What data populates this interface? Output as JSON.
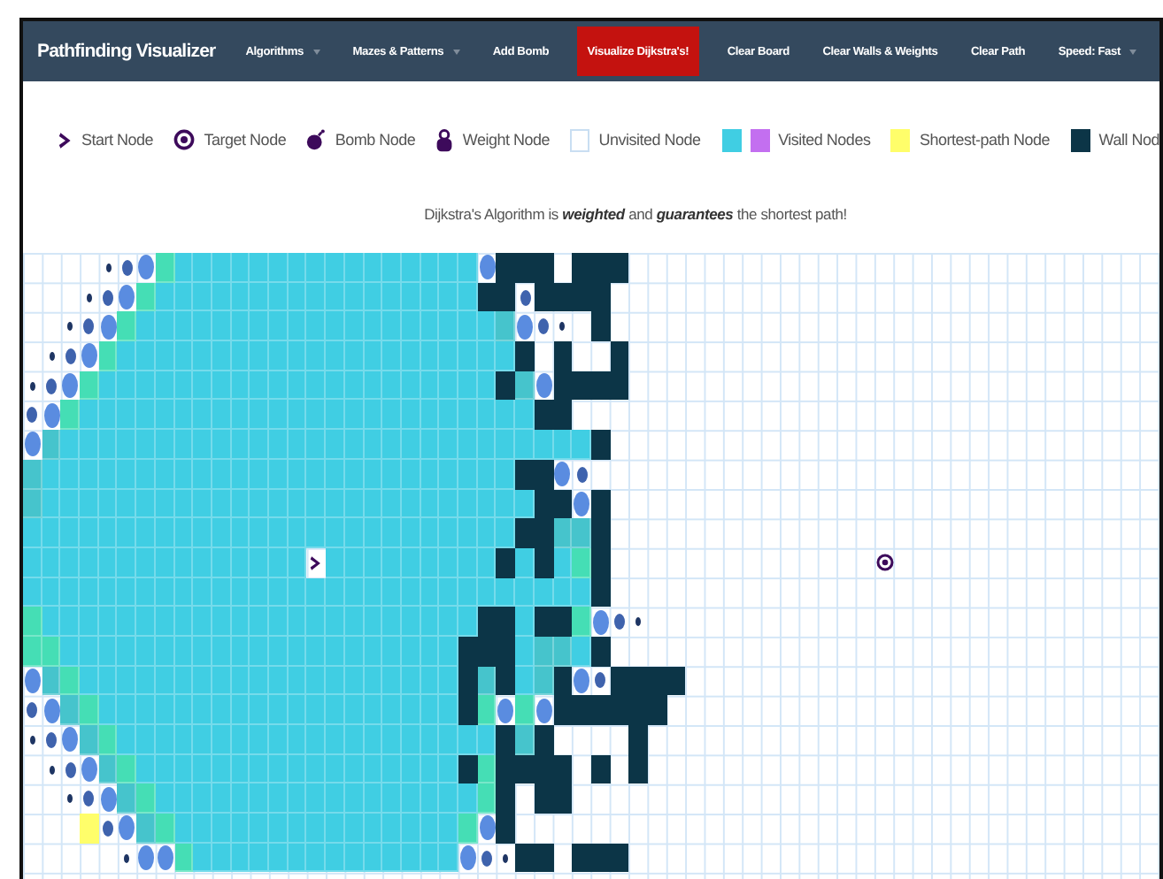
{
  "navbar": {
    "brand": "Pathfinding Visualizer",
    "items": [
      {
        "label": "Algorithms",
        "kind": "dropdown"
      },
      {
        "label": "Mazes & Patterns",
        "kind": "dropdown"
      },
      {
        "label": "Add Bomb",
        "kind": "link"
      },
      {
        "label": "Visualize Dijkstra's!",
        "kind": "primary"
      },
      {
        "label": "Clear Board",
        "kind": "link"
      },
      {
        "label": "Clear Walls & Weights",
        "kind": "link"
      },
      {
        "label": "Clear Path",
        "kind": "link"
      },
      {
        "label": "Speed: Fast",
        "kind": "dropdown"
      }
    ]
  },
  "legend": [
    {
      "kind": "start",
      "label": "Start Node"
    },
    {
      "kind": "target",
      "label": "Target Node"
    },
    {
      "kind": "bomb",
      "label": "Bomb Node"
    },
    {
      "kind": "weight",
      "label": "Weight Node"
    },
    {
      "kind": "unvisited",
      "label": "Unvisited Node"
    },
    {
      "kind": "visited",
      "label": "Visited Nodes"
    },
    {
      "kind": "shortest",
      "label": "Shortest-path Node"
    },
    {
      "kind": "wall",
      "label": "Wall Nod"
    }
  ],
  "description": "Dijkstra's Algorithm is **weighted** and **guarantees** the shortest path!",
  "grid": {
    "rows": [
      {
        "cells": [
          {
            "kind": "open"
          },
          {
            "kind": "open"
          },
          {
            "kind": "open"
          },
          {
            "kind": "open"
          },
          {
            "kind": "far"
          },
          {
            "kind": "queued"
          },
          {
            "kind": "next"
          },
          {
            "kind": "new"
          },
          {
            "kind": "seen"
          },
          {
            "kind": "seen"
          },
          {
            "kind": "seen"
          },
          {
            "kind": "seen"
          },
          {
            "kind": "seen"
          },
          {
            "kind": "seen"
          },
          {
            "kind": "seen"
          },
          {
            "kind": "seen"
          },
          {
            "kind": "seen"
          },
          {
            "kind": "seen"
          },
          {
            "kind": "seen"
          },
          {
            "kind": "seen"
          },
          {
            "kind": "seen"
          },
          {
            "kind": "seen"
          },
          {
            "kind": "seen"
          },
          {
            "kind": "seen"
          },
          {
            "kind": "next"
          },
          {
            "kind": "wall"
          },
          {
            "kind": "wall"
          },
          {
            "kind": "wall"
          },
          {
            "kind": "open"
          },
          {
            "kind": "wall"
          },
          {
            "kind": "wall"
          },
          {
            "kind": "wall"
          }
        ]
      },
      {
        "cells": [
          {
            "kind": "open"
          },
          {
            "kind": "open"
          },
          {
            "kind": "open"
          },
          {
            "kind": "far"
          },
          {
            "kind": "queued"
          },
          {
            "kind": "next"
          },
          {
            "kind": "new"
          },
          {
            "kind": "seen"
          },
          {
            "kind": "seen"
          },
          {
            "kind": "seen"
          },
          {
            "kind": "seen"
          },
          {
            "kind": "seen"
          },
          {
            "kind": "seen"
          },
          {
            "kind": "seen"
          },
          {
            "kind": "seen"
          },
          {
            "kind": "seen"
          },
          {
            "kind": "seen"
          },
          {
            "kind": "seen"
          },
          {
            "kind": "seen"
          },
          {
            "kind": "seen"
          },
          {
            "kind": "seen"
          },
          {
            "kind": "seen"
          },
          {
            "kind": "seen"
          },
          {
            "kind": "seen"
          },
          {
            "kind": "wall"
          },
          {
            "kind": "wall"
          },
          {
            "kind": "queued"
          },
          {
            "kind": "wall"
          },
          {
            "kind": "wall"
          },
          {
            "kind": "wall"
          },
          {
            "kind": "wall"
          }
        ]
      },
      {
        "cells": [
          {
            "kind": "open"
          },
          {
            "kind": "open"
          },
          {
            "kind": "far"
          },
          {
            "kind": "queued"
          },
          {
            "kind": "next"
          },
          {
            "kind": "new"
          },
          {
            "kind": "seen"
          },
          {
            "kind": "seen"
          },
          {
            "kind": "seen"
          },
          {
            "kind": "seen"
          },
          {
            "kind": "seen"
          },
          {
            "kind": "seen"
          },
          {
            "kind": "seen"
          },
          {
            "kind": "seen"
          },
          {
            "kind": "seen"
          },
          {
            "kind": "seen"
          },
          {
            "kind": "seen"
          },
          {
            "kind": "seen"
          },
          {
            "kind": "seen"
          },
          {
            "kind": "seen"
          },
          {
            "kind": "seen"
          },
          {
            "kind": "seen"
          },
          {
            "kind": "seen"
          },
          {
            "kind": "seen"
          },
          {
            "kind": "seen"
          },
          {
            "kind": "near"
          },
          {
            "kind": "next"
          },
          {
            "kind": "queued"
          },
          {
            "kind": "far"
          },
          {
            "kind": "open"
          },
          {
            "kind": "wall"
          }
        ]
      },
      {
        "cells": [
          {
            "kind": "open"
          },
          {
            "kind": "far"
          },
          {
            "kind": "queued"
          },
          {
            "kind": "next"
          },
          {
            "kind": "new"
          },
          {
            "kind": "seen"
          },
          {
            "kind": "seen"
          },
          {
            "kind": "seen"
          },
          {
            "kind": "seen"
          },
          {
            "kind": "seen"
          },
          {
            "kind": "seen"
          },
          {
            "kind": "seen"
          },
          {
            "kind": "seen"
          },
          {
            "kind": "seen"
          },
          {
            "kind": "seen"
          },
          {
            "kind": "seen"
          },
          {
            "kind": "seen"
          },
          {
            "kind": "seen"
          },
          {
            "kind": "seen"
          },
          {
            "kind": "seen"
          },
          {
            "kind": "seen"
          },
          {
            "kind": "seen"
          },
          {
            "kind": "seen"
          },
          {
            "kind": "seen"
          },
          {
            "kind": "seen"
          },
          {
            "kind": "seen"
          },
          {
            "kind": "wall"
          },
          {
            "kind": "open"
          },
          {
            "kind": "wall"
          },
          {
            "kind": "open"
          },
          {
            "kind": "open"
          },
          {
            "kind": "wall"
          }
        ]
      },
      {
        "cells": [
          {
            "kind": "far"
          },
          {
            "kind": "queued"
          },
          {
            "kind": "next"
          },
          {
            "kind": "new"
          },
          {
            "kind": "seen"
          },
          {
            "kind": "seen"
          },
          {
            "kind": "seen"
          },
          {
            "kind": "seen"
          },
          {
            "kind": "seen"
          },
          {
            "kind": "seen"
          },
          {
            "kind": "seen"
          },
          {
            "kind": "seen"
          },
          {
            "kind": "seen"
          },
          {
            "kind": "seen"
          },
          {
            "kind": "seen"
          },
          {
            "kind": "seen"
          },
          {
            "kind": "seen"
          },
          {
            "kind": "seen"
          },
          {
            "kind": "seen"
          },
          {
            "kind": "seen"
          },
          {
            "kind": "seen"
          },
          {
            "kind": "seen"
          },
          {
            "kind": "seen"
          },
          {
            "kind": "seen"
          },
          {
            "kind": "seen"
          },
          {
            "kind": "wall"
          },
          {
            "kind": "near"
          },
          {
            "kind": "next"
          },
          {
            "kind": "wall"
          },
          {
            "kind": "wall"
          },
          {
            "kind": "wall"
          },
          {
            "kind": "wall"
          }
        ]
      },
      {
        "cells": [
          {
            "kind": "queued"
          },
          {
            "kind": "next"
          },
          {
            "kind": "new"
          },
          {
            "kind": "seen"
          },
          {
            "kind": "seen"
          },
          {
            "kind": "seen"
          },
          {
            "kind": "seen"
          },
          {
            "kind": "seen"
          },
          {
            "kind": "seen"
          },
          {
            "kind": "seen"
          },
          {
            "kind": "seen"
          },
          {
            "kind": "seen"
          },
          {
            "kind": "seen"
          },
          {
            "kind": "seen"
          },
          {
            "kind": "seen"
          },
          {
            "kind": "seen"
          },
          {
            "kind": "seen"
          },
          {
            "kind": "seen"
          },
          {
            "kind": "seen"
          },
          {
            "kind": "seen"
          },
          {
            "kind": "seen"
          },
          {
            "kind": "seen"
          },
          {
            "kind": "seen"
          },
          {
            "kind": "seen"
          },
          {
            "kind": "seen"
          },
          {
            "kind": "seen"
          },
          {
            "kind": "seen"
          },
          {
            "kind": "wall"
          },
          {
            "kind": "wall"
          }
        ]
      },
      {
        "cells": [
          {
            "kind": "next"
          },
          {
            "kind": "near"
          },
          {
            "kind": "seen"
          },
          {
            "kind": "seen"
          },
          {
            "kind": "seen"
          },
          {
            "kind": "seen"
          },
          {
            "kind": "seen"
          },
          {
            "kind": "seen"
          },
          {
            "kind": "seen"
          },
          {
            "kind": "seen"
          },
          {
            "kind": "seen"
          },
          {
            "kind": "seen"
          },
          {
            "kind": "seen"
          },
          {
            "kind": "seen"
          },
          {
            "kind": "seen"
          },
          {
            "kind": "seen"
          },
          {
            "kind": "seen"
          },
          {
            "kind": "seen"
          },
          {
            "kind": "seen"
          },
          {
            "kind": "seen"
          },
          {
            "kind": "seen"
          },
          {
            "kind": "seen"
          },
          {
            "kind": "seen"
          },
          {
            "kind": "seen"
          },
          {
            "kind": "seen"
          },
          {
            "kind": "seen"
          },
          {
            "kind": "seen"
          },
          {
            "kind": "seen"
          },
          {
            "kind": "seen"
          },
          {
            "kind": "seen"
          },
          {
            "kind": "wall"
          }
        ]
      },
      {
        "cells": [
          {
            "kind": "near"
          },
          {
            "kind": "seen"
          },
          {
            "kind": "seen"
          },
          {
            "kind": "seen"
          },
          {
            "kind": "seen"
          },
          {
            "kind": "seen"
          },
          {
            "kind": "seen"
          },
          {
            "kind": "seen"
          },
          {
            "kind": "seen"
          },
          {
            "kind": "seen"
          },
          {
            "kind": "seen"
          },
          {
            "kind": "seen"
          },
          {
            "kind": "seen"
          },
          {
            "kind": "seen"
          },
          {
            "kind": "seen"
          },
          {
            "kind": "seen"
          },
          {
            "kind": "seen"
          },
          {
            "kind": "seen"
          },
          {
            "kind": "seen"
          },
          {
            "kind": "seen"
          },
          {
            "kind": "seen"
          },
          {
            "kind": "seen"
          },
          {
            "kind": "seen"
          },
          {
            "kind": "seen"
          },
          {
            "kind": "seen"
          },
          {
            "kind": "seen"
          },
          {
            "kind": "wall"
          },
          {
            "kind": "wall"
          },
          {
            "kind": "next"
          },
          {
            "kind": "queued"
          }
        ]
      },
      {
        "cells": [
          {
            "kind": "near"
          },
          {
            "kind": "seen"
          },
          {
            "kind": "seen"
          },
          {
            "kind": "seen"
          },
          {
            "kind": "seen"
          },
          {
            "kind": "seen"
          },
          {
            "kind": "seen"
          },
          {
            "kind": "seen"
          },
          {
            "kind": "seen"
          },
          {
            "kind": "seen"
          },
          {
            "kind": "seen"
          },
          {
            "kind": "seen"
          },
          {
            "kind": "seen"
          },
          {
            "kind": "seen"
          },
          {
            "kind": "seen"
          },
          {
            "kind": "seen"
          },
          {
            "kind": "seen"
          },
          {
            "kind": "seen"
          },
          {
            "kind": "seen"
          },
          {
            "kind": "seen"
          },
          {
            "kind": "seen"
          },
          {
            "kind": "seen"
          },
          {
            "kind": "seen"
          },
          {
            "kind": "seen"
          },
          {
            "kind": "seen"
          },
          {
            "kind": "seen"
          },
          {
            "kind": "seen"
          },
          {
            "kind": "wall"
          },
          {
            "kind": "wall"
          },
          {
            "kind": "next"
          },
          {
            "kind": "wall"
          }
        ]
      },
      {
        "cells": [
          {
            "kind": "seen"
          },
          {
            "kind": "seen"
          },
          {
            "kind": "seen"
          },
          {
            "kind": "seen"
          },
          {
            "kind": "seen"
          },
          {
            "kind": "seen"
          },
          {
            "kind": "seen"
          },
          {
            "kind": "seen"
          },
          {
            "kind": "seen"
          },
          {
            "kind": "seen"
          },
          {
            "kind": "seen"
          },
          {
            "kind": "seen"
          },
          {
            "kind": "seen"
          },
          {
            "kind": "seen"
          },
          {
            "kind": "seen"
          },
          {
            "kind": "seen"
          },
          {
            "kind": "seen"
          },
          {
            "kind": "seen"
          },
          {
            "kind": "seen"
          },
          {
            "kind": "seen"
          },
          {
            "kind": "seen"
          },
          {
            "kind": "seen"
          },
          {
            "kind": "seen"
          },
          {
            "kind": "seen"
          },
          {
            "kind": "seen"
          },
          {
            "kind": "seen"
          },
          {
            "kind": "wall"
          },
          {
            "kind": "wall"
          },
          {
            "kind": "near"
          },
          {
            "kind": "near"
          },
          {
            "kind": "wall"
          }
        ]
      },
      {
        "cells": [
          {
            "kind": "seen"
          },
          {
            "kind": "seen"
          },
          {
            "kind": "seen"
          },
          {
            "kind": "seen"
          },
          {
            "kind": "seen"
          },
          {
            "kind": "seen"
          },
          {
            "kind": "seen"
          },
          {
            "kind": "seen"
          },
          {
            "kind": "seen"
          },
          {
            "kind": "seen"
          },
          {
            "kind": "seen"
          },
          {
            "kind": "seen"
          },
          {
            "kind": "seen"
          },
          {
            "kind": "seen"
          },
          {
            "kind": "seen"
          },
          {
            "kind": "start"
          },
          {
            "kind": "seen"
          },
          {
            "kind": "seen"
          },
          {
            "kind": "seen"
          },
          {
            "kind": "seen"
          },
          {
            "kind": "seen"
          },
          {
            "kind": "seen"
          },
          {
            "kind": "seen"
          },
          {
            "kind": "seen"
          },
          {
            "kind": "seen"
          },
          {
            "kind": "wall"
          },
          {
            "kind": "seen"
          },
          {
            "kind": "wall"
          },
          {
            "kind": "seen"
          },
          {
            "kind": "new"
          },
          {
            "kind": "wall"
          },
          {
            "kind": "open"
          },
          {
            "kind": "open"
          },
          {
            "kind": "open"
          },
          {
            "kind": "open"
          },
          {
            "kind": "open"
          },
          {
            "kind": "open"
          },
          {
            "kind": "open"
          },
          {
            "kind": "open"
          },
          {
            "kind": "open"
          },
          {
            "kind": "open"
          },
          {
            "kind": "open"
          },
          {
            "kind": "open"
          },
          {
            "kind": "open"
          },
          {
            "kind": "open"
          },
          {
            "kind": "target"
          }
        ]
      },
      {
        "cells": [
          {
            "kind": "seen"
          },
          {
            "kind": "seen"
          },
          {
            "kind": "seen"
          },
          {
            "kind": "seen"
          },
          {
            "kind": "seen"
          },
          {
            "kind": "seen"
          },
          {
            "kind": "seen"
          },
          {
            "kind": "seen"
          },
          {
            "kind": "seen"
          },
          {
            "kind": "seen"
          },
          {
            "kind": "seen"
          },
          {
            "kind": "seen"
          },
          {
            "kind": "seen"
          },
          {
            "kind": "seen"
          },
          {
            "kind": "seen"
          },
          {
            "kind": "seen"
          },
          {
            "kind": "seen"
          },
          {
            "kind": "seen"
          },
          {
            "kind": "seen"
          },
          {
            "kind": "seen"
          },
          {
            "kind": "seen"
          },
          {
            "kind": "seen"
          },
          {
            "kind": "seen"
          },
          {
            "kind": "seen"
          },
          {
            "kind": "seen"
          },
          {
            "kind": "seen"
          },
          {
            "kind": "seen"
          },
          {
            "kind": "seen"
          },
          {
            "kind": "seen"
          },
          {
            "kind": "seen"
          },
          {
            "kind": "wall"
          }
        ]
      },
      {
        "cells": [
          {
            "kind": "new"
          },
          {
            "kind": "seen"
          },
          {
            "kind": "seen"
          },
          {
            "kind": "seen"
          },
          {
            "kind": "seen"
          },
          {
            "kind": "seen"
          },
          {
            "kind": "seen"
          },
          {
            "kind": "seen"
          },
          {
            "kind": "seen"
          },
          {
            "kind": "seen"
          },
          {
            "kind": "seen"
          },
          {
            "kind": "seen"
          },
          {
            "kind": "seen"
          },
          {
            "kind": "seen"
          },
          {
            "kind": "seen"
          },
          {
            "kind": "seen"
          },
          {
            "kind": "seen"
          },
          {
            "kind": "seen"
          },
          {
            "kind": "seen"
          },
          {
            "kind": "seen"
          },
          {
            "kind": "seen"
          },
          {
            "kind": "seen"
          },
          {
            "kind": "seen"
          },
          {
            "kind": "seen"
          },
          {
            "kind": "wall"
          },
          {
            "kind": "wall"
          },
          {
            "kind": "seen"
          },
          {
            "kind": "wall"
          },
          {
            "kind": "wall"
          },
          {
            "kind": "new"
          },
          {
            "kind": "next"
          },
          {
            "kind": "queued"
          },
          {
            "kind": "far"
          }
        ]
      },
      {
        "cells": [
          {
            "kind": "new"
          },
          {
            "kind": "new"
          },
          {
            "kind": "seen"
          },
          {
            "kind": "seen"
          },
          {
            "kind": "seen"
          },
          {
            "kind": "seen"
          },
          {
            "kind": "seen"
          },
          {
            "kind": "seen"
          },
          {
            "kind": "seen"
          },
          {
            "kind": "seen"
          },
          {
            "kind": "seen"
          },
          {
            "kind": "seen"
          },
          {
            "kind": "seen"
          },
          {
            "kind": "seen"
          },
          {
            "kind": "seen"
          },
          {
            "kind": "seen"
          },
          {
            "kind": "seen"
          },
          {
            "kind": "seen"
          },
          {
            "kind": "seen"
          },
          {
            "kind": "seen"
          },
          {
            "kind": "seen"
          },
          {
            "kind": "seen"
          },
          {
            "kind": "seen"
          },
          {
            "kind": "wall"
          },
          {
            "kind": "wall"
          },
          {
            "kind": "wall"
          },
          {
            "kind": "seen"
          },
          {
            "kind": "near"
          },
          {
            "kind": "near"
          },
          {
            "kind": "seen"
          },
          {
            "kind": "wall"
          }
        ]
      },
      {
        "cells": [
          {
            "kind": "next"
          },
          {
            "kind": "near"
          },
          {
            "kind": "new"
          },
          {
            "kind": "seen"
          },
          {
            "kind": "seen"
          },
          {
            "kind": "seen"
          },
          {
            "kind": "seen"
          },
          {
            "kind": "seen"
          },
          {
            "kind": "seen"
          },
          {
            "kind": "seen"
          },
          {
            "kind": "seen"
          },
          {
            "kind": "seen"
          },
          {
            "kind": "seen"
          },
          {
            "kind": "seen"
          },
          {
            "kind": "seen"
          },
          {
            "kind": "seen"
          },
          {
            "kind": "seen"
          },
          {
            "kind": "seen"
          },
          {
            "kind": "seen"
          },
          {
            "kind": "seen"
          },
          {
            "kind": "seen"
          },
          {
            "kind": "seen"
          },
          {
            "kind": "seen"
          },
          {
            "kind": "wall"
          },
          {
            "kind": "near"
          },
          {
            "kind": "wall"
          },
          {
            "kind": "seen"
          },
          {
            "kind": "near"
          },
          {
            "kind": "wall"
          },
          {
            "kind": "next"
          },
          {
            "kind": "queued"
          },
          {
            "kind": "wall"
          },
          {
            "kind": "wall"
          },
          {
            "kind": "wall"
          },
          {
            "kind": "wall"
          }
        ]
      },
      {
        "cells": [
          {
            "kind": "queued"
          },
          {
            "kind": "next"
          },
          {
            "kind": "near"
          },
          {
            "kind": "new"
          },
          {
            "kind": "seen"
          },
          {
            "kind": "seen"
          },
          {
            "kind": "seen"
          },
          {
            "kind": "seen"
          },
          {
            "kind": "seen"
          },
          {
            "kind": "seen"
          },
          {
            "kind": "seen"
          },
          {
            "kind": "seen"
          },
          {
            "kind": "seen"
          },
          {
            "kind": "seen"
          },
          {
            "kind": "seen"
          },
          {
            "kind": "seen"
          },
          {
            "kind": "seen"
          },
          {
            "kind": "seen"
          },
          {
            "kind": "seen"
          },
          {
            "kind": "seen"
          },
          {
            "kind": "seen"
          },
          {
            "kind": "seen"
          },
          {
            "kind": "seen"
          },
          {
            "kind": "wall"
          },
          {
            "kind": "new"
          },
          {
            "kind": "next"
          },
          {
            "kind": "new"
          },
          {
            "kind": "next"
          },
          {
            "kind": "wall"
          },
          {
            "kind": "wall"
          },
          {
            "kind": "wall"
          },
          {
            "kind": "wall"
          },
          {
            "kind": "wall"
          },
          {
            "kind": "wall"
          }
        ]
      },
      {
        "cells": [
          {
            "kind": "far"
          },
          {
            "kind": "queued"
          },
          {
            "kind": "next"
          },
          {
            "kind": "near"
          },
          {
            "kind": "new"
          },
          {
            "kind": "seen"
          },
          {
            "kind": "seen"
          },
          {
            "kind": "seen"
          },
          {
            "kind": "seen"
          },
          {
            "kind": "seen"
          },
          {
            "kind": "seen"
          },
          {
            "kind": "seen"
          },
          {
            "kind": "seen"
          },
          {
            "kind": "seen"
          },
          {
            "kind": "seen"
          },
          {
            "kind": "seen"
          },
          {
            "kind": "seen"
          },
          {
            "kind": "seen"
          },
          {
            "kind": "seen"
          },
          {
            "kind": "seen"
          },
          {
            "kind": "seen"
          },
          {
            "kind": "seen"
          },
          {
            "kind": "seen"
          },
          {
            "kind": "seen"
          },
          {
            "kind": "seen"
          },
          {
            "kind": "wall"
          },
          {
            "kind": "near"
          },
          {
            "kind": "wall"
          },
          {
            "kind": "open"
          },
          {
            "kind": "open"
          },
          {
            "kind": "open"
          },
          {
            "kind": "open"
          },
          {
            "kind": "wall"
          }
        ]
      },
      {
        "cells": [
          {
            "kind": "open"
          },
          {
            "kind": "far"
          },
          {
            "kind": "queued"
          },
          {
            "kind": "next"
          },
          {
            "kind": "near"
          },
          {
            "kind": "new"
          },
          {
            "kind": "seen"
          },
          {
            "kind": "seen"
          },
          {
            "kind": "seen"
          },
          {
            "kind": "seen"
          },
          {
            "kind": "seen"
          },
          {
            "kind": "seen"
          },
          {
            "kind": "seen"
          },
          {
            "kind": "seen"
          },
          {
            "kind": "seen"
          },
          {
            "kind": "seen"
          },
          {
            "kind": "seen"
          },
          {
            "kind": "seen"
          },
          {
            "kind": "seen"
          },
          {
            "kind": "seen"
          },
          {
            "kind": "seen"
          },
          {
            "kind": "seen"
          },
          {
            "kind": "seen"
          },
          {
            "kind": "wall"
          },
          {
            "kind": "new"
          },
          {
            "kind": "wall"
          },
          {
            "kind": "wall"
          },
          {
            "kind": "wall"
          },
          {
            "kind": "wall"
          },
          {
            "kind": "open"
          },
          {
            "kind": "wall"
          },
          {
            "kind": "open"
          },
          {
            "kind": "wall"
          }
        ]
      },
      {
        "cells": [
          {
            "kind": "open"
          },
          {
            "kind": "open"
          },
          {
            "kind": "far"
          },
          {
            "kind": "queued"
          },
          {
            "kind": "next"
          },
          {
            "kind": "near"
          },
          {
            "kind": "new"
          },
          {
            "kind": "seen"
          },
          {
            "kind": "seen"
          },
          {
            "kind": "seen"
          },
          {
            "kind": "seen"
          },
          {
            "kind": "seen"
          },
          {
            "kind": "seen"
          },
          {
            "kind": "seen"
          },
          {
            "kind": "seen"
          },
          {
            "kind": "seen"
          },
          {
            "kind": "seen"
          },
          {
            "kind": "seen"
          },
          {
            "kind": "seen"
          },
          {
            "kind": "seen"
          },
          {
            "kind": "seen"
          },
          {
            "kind": "seen"
          },
          {
            "kind": "seen"
          },
          {
            "kind": "seen"
          },
          {
            "kind": "new"
          },
          {
            "kind": "wall"
          },
          {
            "kind": "open"
          },
          {
            "kind": "wall"
          },
          {
            "kind": "wall"
          }
        ]
      },
      {
        "cells": [
          {
            "kind": "open"
          },
          {
            "kind": "open"
          },
          {
            "kind": "open"
          },
          {
            "kind": "path"
          },
          {
            "kind": "queued"
          },
          {
            "kind": "next"
          },
          {
            "kind": "near"
          },
          {
            "kind": "new"
          },
          {
            "kind": "seen"
          },
          {
            "kind": "seen"
          },
          {
            "kind": "seen"
          },
          {
            "kind": "seen"
          },
          {
            "kind": "seen"
          },
          {
            "kind": "seen"
          },
          {
            "kind": "seen"
          },
          {
            "kind": "seen"
          },
          {
            "kind": "seen"
          },
          {
            "kind": "seen"
          },
          {
            "kind": "seen"
          },
          {
            "kind": "seen"
          },
          {
            "kind": "seen"
          },
          {
            "kind": "seen"
          },
          {
            "kind": "seen"
          },
          {
            "kind": "new"
          },
          {
            "kind": "next"
          },
          {
            "kind": "wall"
          }
        ]
      },
      {
        "cells": [
          {
            "kind": "open"
          },
          {
            "kind": "open"
          },
          {
            "kind": "open"
          },
          {
            "kind": "open"
          },
          {
            "kind": "open"
          },
          {
            "kind": "far"
          },
          {
            "kind": "next"
          },
          {
            "kind": "next"
          },
          {
            "kind": "new"
          },
          {
            "kind": "seen"
          },
          {
            "kind": "seen"
          },
          {
            "kind": "seen"
          },
          {
            "kind": "seen"
          },
          {
            "kind": "seen"
          },
          {
            "kind": "seen"
          },
          {
            "kind": "seen"
          },
          {
            "kind": "seen"
          },
          {
            "kind": "seen"
          },
          {
            "kind": "seen"
          },
          {
            "kind": "seen"
          },
          {
            "kind": "seen"
          },
          {
            "kind": "seen"
          },
          {
            "kind": "seen"
          },
          {
            "kind": "next"
          },
          {
            "kind": "queued"
          },
          {
            "kind": "far"
          },
          {
            "kind": "wall"
          },
          {
            "kind": "wall"
          },
          {
            "kind": "open"
          },
          {
            "kind": "wall"
          },
          {
            "kind": "wall"
          },
          {
            "kind": "wall"
          }
        ]
      }
    ]
  }
}
